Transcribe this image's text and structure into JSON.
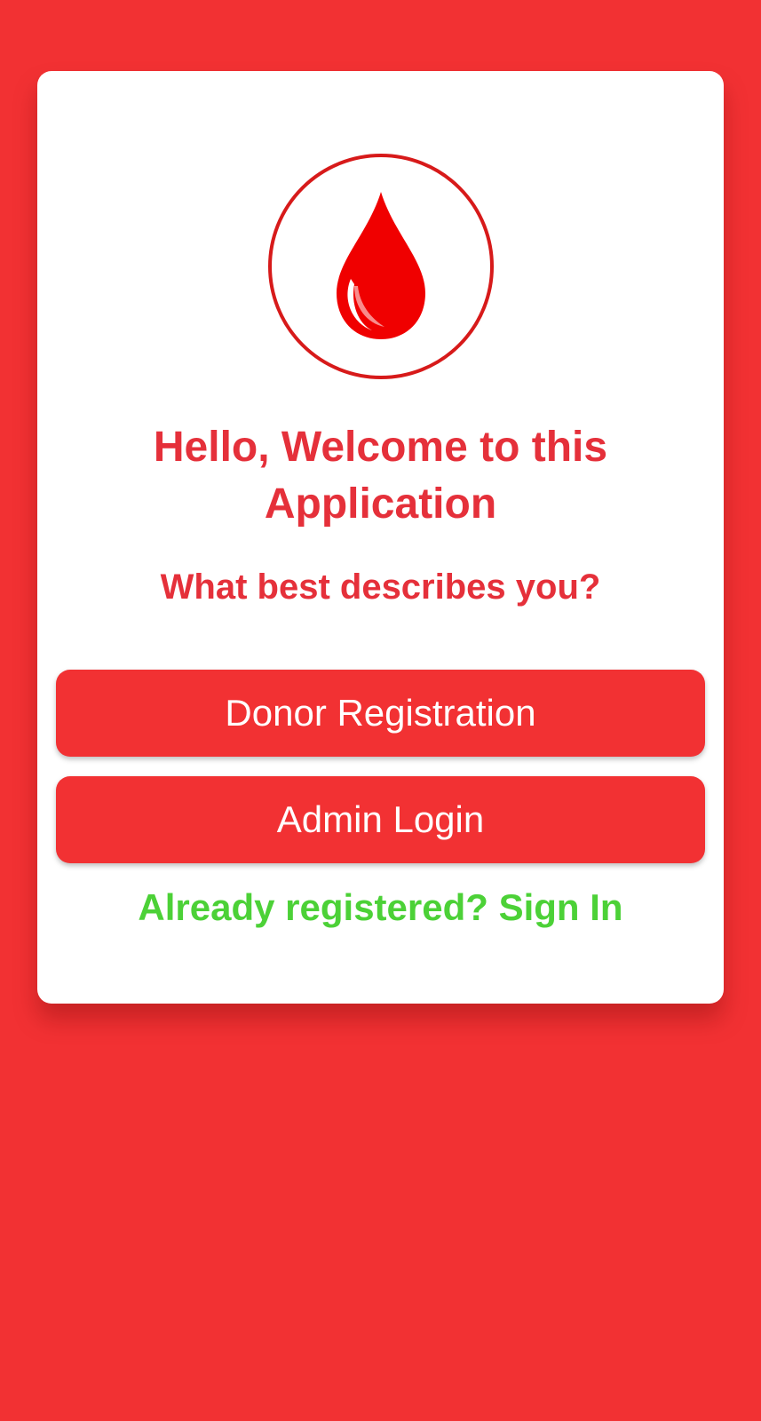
{
  "colors": {
    "background": "#F23133",
    "card": "#FFFFFF",
    "accent_text": "#E5303A",
    "button": "#F23133",
    "button_text": "#FFFFFF",
    "link": "#4CD137",
    "logo": "#E81C1C"
  },
  "logo": {
    "icon": "blood-drop-icon"
  },
  "welcome": {
    "title": "Hello, Welcome to this Application",
    "question": "What best describes you?"
  },
  "actions": {
    "donor_registration_label": "Donor Registration",
    "admin_login_label": "Admin Login",
    "sign_in_link": "Already registered? Sign In"
  }
}
